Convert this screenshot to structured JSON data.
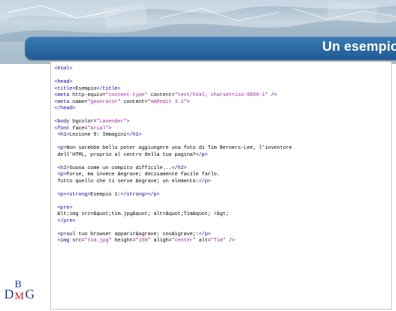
{
  "slide": {
    "title": "Un esempio",
    "colors": {
      "title_bar": "#1f5a94",
      "tag": "#00008b",
      "string": "#9b1ea0",
      "logo_blue": "#1f3f8f",
      "logo_red": "#c0202a"
    }
  },
  "logo": {
    "d": "D",
    "b": "B",
    "m": "M",
    "g": "G"
  },
  "code": {
    "l1": "<html>",
    "l2": "<head>",
    "l3_tag1": "<title>",
    "l3_text": "Esempio",
    "l3_tag2": "</title>",
    "l4_tag": "<meta",
    "l4_attr1": " http-equiv=",
    "l4_val1": "\"content-type\"",
    "l4_attr2": " content=",
    "l4_val2": "\"text/html; charset=iso-8859-1\"",
    "l4_end": " />",
    "l5_tag": "<meta",
    "l5_attr1": " name=",
    "l5_val1": "\"generator\"",
    "l5_attr2": " content=",
    "l5_val2": "\"HAPedit 3.1\"",
    "l5_end": ">",
    "l6": "</head>",
    "l7_tag": "<body",
    "l7_attr": " bgcolor=",
    "l7_val": "\"Lavender\"",
    "l7_end": ">",
    "l8_tag": "<font",
    "l8_attr": " face=",
    "l8_val": "\"Arial\"",
    "l8_end": ">",
    "l9_tag1": "<h1>",
    "l9_text": "Lezione 9: Immagini",
    "l9_tag2": "</h1>",
    "l10_tag": "<p>",
    "l10_text": "Non sarebbe bello poter aggiungere una foto di Tim Berners-Lee, l'inventore",
    "l11_text": "dell'HTML, proprio al centro della tua pagina?",
    "l11_tag": "</p>",
    "l12_tag1": "<h2>",
    "l12_text": "Suona come un compito difficile...",
    "l12_tag2": "</h2>",
    "l13_tag": "<p>",
    "l13_text": "Forse, ma invece &egrave; decisamente facile farlo.",
    "l14_text": "Tutto quello che ti serve &egrave; un elemento:",
    "l14_tag": "</p>",
    "l15_tag1": "<p><strong>",
    "l15_text": "Esempio 1:",
    "l15_tag2": "</strong></p>",
    "l16_tag": "<pre>",
    "l17_text": "&lt;img src=&quot;tim.jpg&quot; alt=&quot;Tim&quot; /&gt;",
    "l18_tag": "</pre>",
    "l19_tag1": "<p>",
    "l19_text": "sul tuo browser apparir&agrave; cos&igrave;:",
    "l19_tag2": "</p>",
    "l20_tag": "<img",
    "l20_attr1": " src=",
    "l20_val1": "\"tim.jpg\"",
    "l20_attr2": " height=",
    "l20_val2": "\"150\"",
    "l20_attr3": " aligh=",
    "l20_val3": "\"center\"",
    "l20_attr4": " alt=",
    "l20_val4": "\"Tim\"",
    "l20_end": " />"
  }
}
